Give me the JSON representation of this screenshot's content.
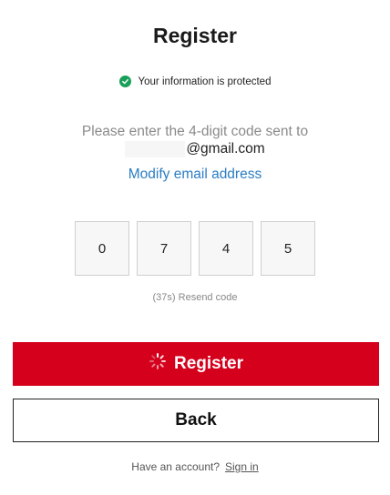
{
  "header": {
    "title": "Register"
  },
  "security": {
    "text": "Your information is protected",
    "icon": "shield-check-icon",
    "color": "#18a058"
  },
  "verification": {
    "instruction": "Please enter the 4-digit code sent to",
    "email_suffix": "@gmail.com",
    "modify_link": "Modify email address",
    "code_digits": [
      "0",
      "7",
      "4",
      "5"
    ],
    "resend_text": "(37s) Resend code"
  },
  "actions": {
    "register_label": "Register",
    "register_color": "#d5001c",
    "back_label": "Back"
  },
  "footer": {
    "account_prompt": "Have an account?",
    "signin_label": "Sign in"
  }
}
